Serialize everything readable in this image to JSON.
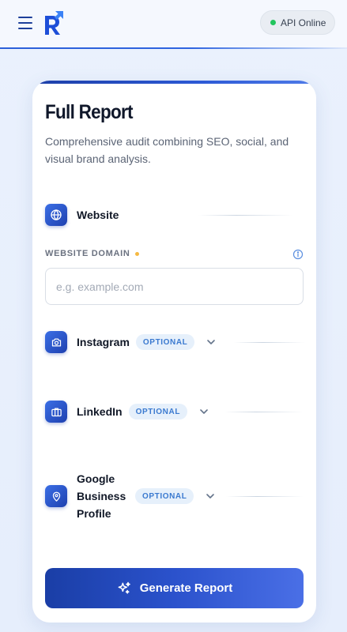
{
  "header": {
    "status_label": "API Online",
    "status_color": "#22c55e",
    "brand_color": "#1d4ed8"
  },
  "card": {
    "title": "Full Report",
    "subtitle": "Comprehensive audit combining SEO, social, and visual brand analysis."
  },
  "website": {
    "label": "Website",
    "icon": "globe-icon",
    "field_label": "WEBSITE DOMAIN",
    "placeholder": "e.g. example.com",
    "value": ""
  },
  "sections": {
    "instagram": {
      "label": "Instagram",
      "badge": "OPTIONAL",
      "icon": "camera-icon"
    },
    "linkedin": {
      "label": "LinkedIn",
      "badge": "OPTIONAL",
      "icon": "briefcase-icon"
    },
    "google": {
      "label": "Google Business Profile",
      "badge": "OPTIONAL",
      "icon": "map-pin-icon"
    }
  },
  "actions": {
    "generate_label": "Generate Report",
    "generate_icon": "sparkles-icon"
  }
}
